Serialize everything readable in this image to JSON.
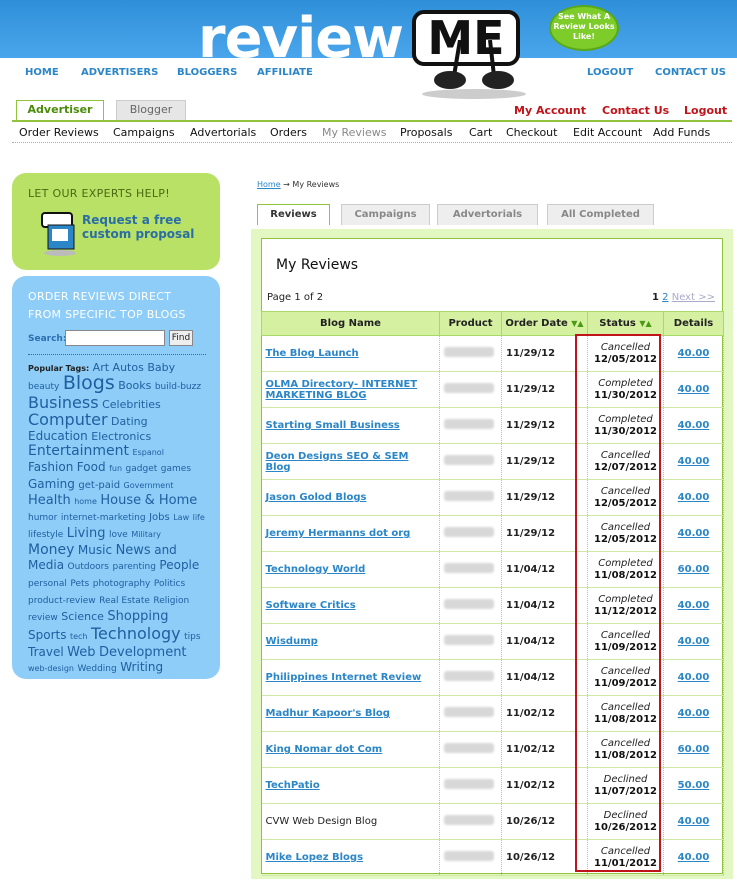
{
  "brand": {
    "logo_text": "review",
    "logo_me": "ME",
    "bubble": "See What A Review Looks Like!"
  },
  "topnav": [
    "HOME",
    "ADVERTISERS",
    "BLOGGERS",
    "AFFILIATE",
    "LOGOUT",
    "CONTACT US"
  ],
  "role_tabs": {
    "active": "Advertiser",
    "inactive": "Blogger"
  },
  "account_links": [
    "My Account",
    "Contact Us",
    "Logout"
  ],
  "subnav": [
    "Order Reviews",
    "Campaigns",
    "Advertorials",
    "Orders",
    "My Reviews",
    "Proposals",
    "Cart",
    "Checkout",
    "Edit Account",
    "Add Funds"
  ],
  "help": {
    "title": "LET OUR EXPERTS HELP!",
    "link": "Request a free custom proposal"
  },
  "panel": {
    "title": "ORDER REVIEWS DIRECT FROM SPECIFIC TOP BLOGS",
    "search_label": "Search:",
    "search_value": "",
    "find_label": "Find",
    "popular_label": "Popular Tags:",
    "tags": [
      [
        "Art",
        11
      ],
      [
        "Autos",
        11
      ],
      [
        "Baby",
        11
      ],
      [
        "beauty",
        9
      ],
      [
        "Blogs",
        19
      ],
      [
        "Books",
        11
      ],
      [
        "build-buzz",
        9
      ],
      [
        "Business",
        16
      ],
      [
        "Celebrities",
        11
      ],
      [
        "Computer",
        16
      ],
      [
        "Dating",
        11
      ],
      [
        "Education",
        12
      ],
      [
        "Electronics",
        11
      ],
      [
        "Entertainment",
        14
      ],
      [
        "Espanol",
        8
      ],
      [
        "Fashion",
        12
      ],
      [
        "Food",
        12
      ],
      [
        "fun",
        8
      ],
      [
        "gadget",
        9
      ],
      [
        "games",
        9
      ],
      [
        "Gaming",
        12
      ],
      [
        "get-paid",
        10
      ],
      [
        "Government",
        8
      ],
      [
        "Health",
        13
      ],
      [
        "home",
        8
      ],
      [
        "House",
        13
      ],
      [
        "& Home",
        13
      ],
      [
        "humor",
        9
      ],
      [
        "internet-marketing",
        9
      ],
      [
        "Jobs",
        10
      ],
      [
        "Law",
        8
      ],
      [
        "life",
        8
      ],
      [
        "lifestyle",
        9
      ],
      [
        "Living",
        13
      ],
      [
        "love",
        9
      ],
      [
        "Military",
        8
      ],
      [
        "Money",
        14
      ],
      [
        "Music",
        12
      ],
      [
        "News",
        13
      ],
      [
        "and Media",
        12
      ],
      [
        "Outdoors",
        9
      ],
      [
        "parenting",
        9
      ],
      [
        "People",
        12
      ],
      [
        "personal",
        9
      ],
      [
        "Pets",
        9
      ],
      [
        "photography",
        9
      ],
      [
        "Politics",
        9
      ],
      [
        "product-review",
        9
      ],
      [
        "Real Estate",
        9
      ],
      [
        "Religion",
        9
      ],
      [
        "review",
        9
      ],
      [
        "Science",
        11
      ],
      [
        "Shopping",
        13
      ],
      [
        "Sports",
        12
      ],
      [
        "tech",
        8
      ],
      [
        "Technology",
        16
      ],
      [
        "tips",
        9
      ],
      [
        "Travel",
        12
      ],
      [
        "Web",
        13
      ],
      [
        "Development",
        13
      ],
      [
        "web-design",
        8
      ],
      [
        "Wedding",
        9
      ],
      [
        "Writing",
        12
      ]
    ]
  },
  "breadcrumb": {
    "home": "Home",
    "sep": "→",
    "current": "My Reviews"
  },
  "content_tabs": [
    "Reviews",
    "Campaigns",
    "Advertorials",
    "All Completed"
  ],
  "reviews": {
    "title": "My Reviews",
    "page_info": "Page 1 of 2",
    "pages": [
      "1",
      "2"
    ],
    "next": "Next >>",
    "columns": [
      "Blog Name",
      "Product",
      "Order Date",
      "Status",
      "Details"
    ],
    "rows": [
      {
        "blog": "The Blog Launch",
        "date": "11/29/12",
        "status": "Cancelled",
        "sdate": "12/05/2012",
        "amount": "40.00",
        "link": true
      },
      {
        "blog": "OLMA Directory- INTERNET MARKETING BLOG",
        "date": "11/29/12",
        "status": "Completed",
        "sdate": "11/30/2012",
        "amount": "40.00",
        "link": true
      },
      {
        "blog": "Starting Small Business",
        "date": "11/29/12",
        "status": "Completed",
        "sdate": "11/30/2012",
        "amount": "40.00",
        "link": true
      },
      {
        "blog": "Deon Designs SEO & SEM Blog",
        "date": "11/29/12",
        "status": "Cancelled",
        "sdate": "12/07/2012",
        "amount": "40.00",
        "link": true
      },
      {
        "blog": "Jason Golod Blogs",
        "date": "11/29/12",
        "status": "Cancelled",
        "sdate": "12/05/2012",
        "amount": "40.00",
        "link": true
      },
      {
        "blog": "Jeremy Hermanns dot org",
        "date": "11/29/12",
        "status": "Cancelled",
        "sdate": "12/05/2012",
        "amount": "40.00",
        "link": true
      },
      {
        "blog": "Technology World",
        "date": "11/04/12",
        "status": "Completed",
        "sdate": "11/08/2012",
        "amount": "60.00",
        "link": true
      },
      {
        "blog": "Software Critics",
        "date": "11/04/12",
        "status": "Completed",
        "sdate": "11/12/2012",
        "amount": "40.00",
        "link": true
      },
      {
        "blog": "Wisdump",
        "date": "11/04/12",
        "status": "Cancelled",
        "sdate": "11/09/2012",
        "amount": "40.00",
        "link": true
      },
      {
        "blog": "Philippines Internet Review",
        "date": "11/04/12",
        "status": "Cancelled",
        "sdate": "11/09/2012",
        "amount": "40.00",
        "link": true
      },
      {
        "blog": "Madhur Kapoor's Blog",
        "date": "11/02/12",
        "status": "Cancelled",
        "sdate": "11/08/2012",
        "amount": "40.00",
        "link": true
      },
      {
        "blog": "King Nomar dot Com",
        "date": "11/02/12",
        "status": "Cancelled",
        "sdate": "11/08/2012",
        "amount": "60.00",
        "link": true
      },
      {
        "blog": "TechPatio",
        "date": "11/02/12",
        "status": "Declined",
        "sdate": "11/07/2012",
        "amount": "50.00",
        "link": true
      },
      {
        "blog": "CVW Web Design Blog",
        "date": "10/26/12",
        "status": "Declined",
        "sdate": "10/26/2012",
        "amount": "40.00",
        "link": false
      },
      {
        "blog": "Mike Lopez Blogs",
        "date": "10/26/12",
        "status": "Cancelled",
        "sdate": "11/01/2012",
        "amount": "40.00",
        "link": true
      }
    ]
  },
  "colors": {
    "blue": "#2b86c8",
    "green": "#8fc43c",
    "red": "#c0141a"
  }
}
